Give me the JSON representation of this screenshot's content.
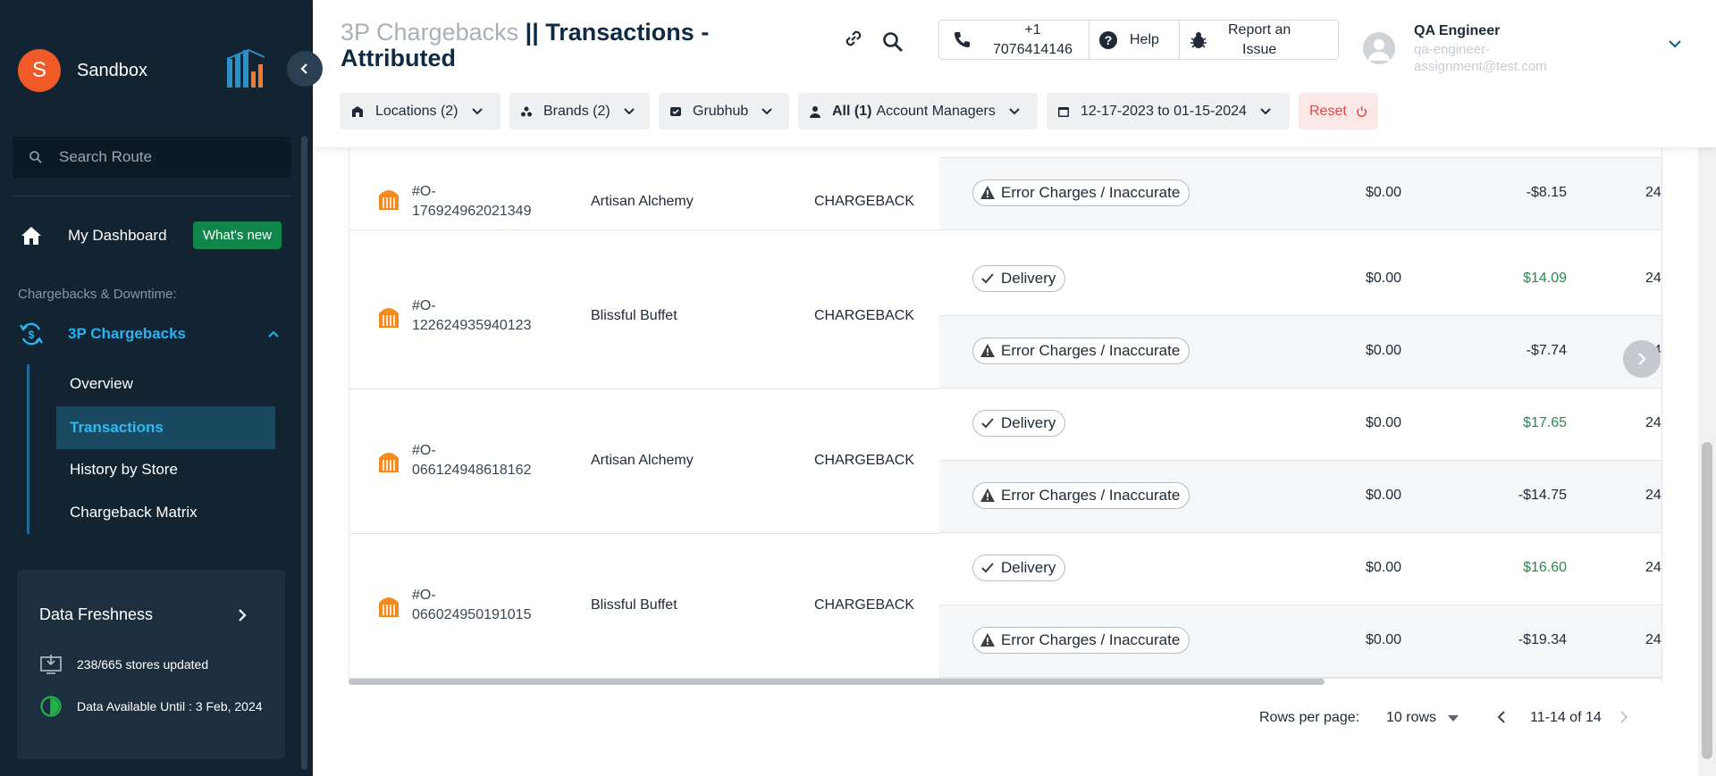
{
  "sidebar": {
    "avatar_letter": "S",
    "workspace": "Sandbox",
    "search_placeholder": "Search Route",
    "dashboard_label": "My Dashboard",
    "whats_new": "What's new",
    "section_label": "Chargebacks & Downtime:",
    "group_label": "3P Chargebacks",
    "items": [
      {
        "label": "Overview",
        "active": false
      },
      {
        "label": "Transactions",
        "active": true
      },
      {
        "label": "History by Store",
        "active": false
      },
      {
        "label": "Chargeback Matrix",
        "active": false
      }
    ],
    "freshness": {
      "title": "Data Freshness",
      "stores_updated": "238/665 stores updated",
      "available_until": "Data Available Until : 3 Feb, 2024"
    }
  },
  "header": {
    "title_prefix": "3P Chargebacks",
    "title_rest": "|| Transactions - Attributed",
    "phone_line1": "+1",
    "phone_line2": "7076414146",
    "help": "Help",
    "report_line1": "Report an",
    "report_line2": "Issue",
    "user_name": "QA Engineer",
    "user_email_line1": "qa-engineer-",
    "user_email_line2": "assignment@test.com"
  },
  "filters": {
    "locations": "Locations (2)",
    "brands": "Brands (2)",
    "platform": "Grubhub",
    "managers_bold": "All (1)",
    "managers_rest": "Account Managers",
    "date_range": "12-17-2023 to 01-15-2024",
    "reset": "Reset"
  },
  "table": {
    "rows": [
      {
        "order_line1": "#O-",
        "order_line2": "176924962021349",
        "store": "Artisan Alchemy",
        "type": "CHARGEBACK",
        "subs": [
          {
            "reason": "Error Charges / Inaccurate",
            "amount1": "$0.00",
            "amount2": "-$8.15",
            "extra": "24"
          }
        ]
      },
      {
        "order_line1": "#O-",
        "order_line2": "122624935940123",
        "store": "Blissful Buffet",
        "type": "CHARGEBACK",
        "subs": [
          {
            "reason": "Delivery",
            "amount1": "$0.00",
            "amount2": "$14.09",
            "extra": "24"
          },
          {
            "reason": "Error Charges / Inaccurate",
            "amount1": "$0.00",
            "amount2": "-$7.74",
            "extra": "24"
          }
        ]
      },
      {
        "order_line1": "#O-",
        "order_line2": "066124948618162",
        "store": "Artisan Alchemy",
        "type": "CHARGEBACK",
        "subs": [
          {
            "reason": "Delivery",
            "amount1": "$0.00",
            "amount2": "$17.65",
            "extra": "24"
          },
          {
            "reason": "Error Charges / Inaccurate",
            "amount1": "$0.00",
            "amount2": "-$14.75",
            "extra": "24"
          }
        ]
      },
      {
        "order_line1": "#O-",
        "order_line2": "066024950191015",
        "store": "Blissful Buffet",
        "type": "CHARGEBACK",
        "subs": [
          {
            "reason": "Delivery",
            "amount1": "$0.00",
            "amount2": "$16.60",
            "extra": "24"
          },
          {
            "reason": "Error Charges / Inaccurate",
            "amount1": "$0.00",
            "amount2": "-$19.34",
            "extra": "24"
          }
        ]
      }
    ]
  },
  "pagination": {
    "rows_per_page_label": "Rows per page:",
    "rows_per_page_value": "10 rows",
    "range": "11-14 of 14"
  },
  "colors": {
    "sidebar_bg": "#122331",
    "accent_blue": "#29b3f0",
    "positive_green": "#2a8a4a",
    "reset_red": "#e04848",
    "brand_orange": "#f05a28"
  }
}
